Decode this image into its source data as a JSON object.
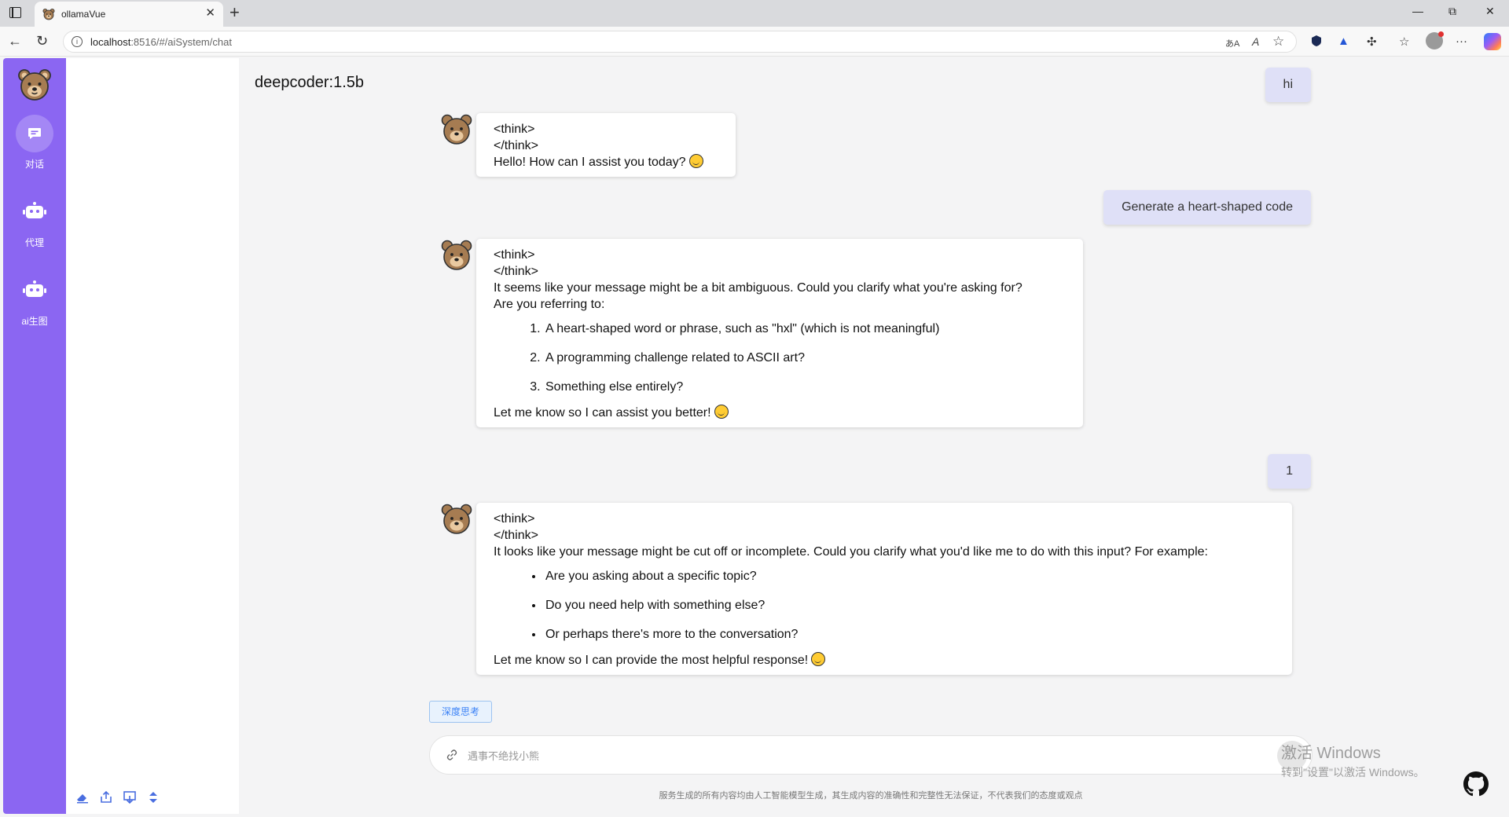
{
  "browser": {
    "tab_title": "ollamaVue",
    "tab_close": "✕",
    "new_tab": "+",
    "url_host": "localhost",
    "url_path": ":8516/#/aiSystem/chat",
    "win_min": "—",
    "win_restore": "⧉",
    "win_close": "✕",
    "back": "←",
    "reload": "↻",
    "translate": "あA",
    "read_aloud": "A",
    "favorite": "☆",
    "more": "···"
  },
  "sidebar": {
    "items": [
      {
        "label": "对话",
        "icon": "chat-icon"
      },
      {
        "label": "代理",
        "icon": "robot-icon"
      },
      {
        "label": "ai生图",
        "icon": "robot-icon"
      }
    ],
    "accent": "#8b66f2"
  },
  "bottom_tools": [
    "eraser-icon",
    "upload-icon",
    "download-icon",
    "sort-icon"
  ],
  "chat": {
    "model_name": "deepcoder:1.5b",
    "messages": [
      {
        "role": "user",
        "text": "hi"
      },
      {
        "role": "ai",
        "think_open": "<think>",
        "think_close": "</think>",
        "text": "Hello! How can I assist you today?"
      },
      {
        "role": "user",
        "text": "Generate a heart-shaped code"
      },
      {
        "role": "ai",
        "think_open": "<think>",
        "think_close": "</think>",
        "intro": "It seems like your message might be a bit ambiguous. Could you clarify what you're asking for?",
        "intro2": "Are you referring to:",
        "list": [
          "A heart-shaped word or phrase, such as \"hxl\" (which is not meaningful)",
          "A programming challenge related to ASCII art?",
          "Something else entirely?"
        ],
        "outro": "Let me know so I can assist you better!"
      },
      {
        "role": "user",
        "text": "1"
      },
      {
        "role": "ai",
        "think_open": "<think>",
        "think_close": "</think>",
        "intro": "It looks like your message might be cut off or incomplete. Could you clarify what you'd like me to do with this input? For example:",
        "list": [
          "Are you asking about a specific topic?",
          "Do you need help with something else?",
          "Or perhaps there's more to the conversation?"
        ],
        "outro": "Let me know so I can provide the most helpful response!"
      }
    ]
  },
  "composer": {
    "deep_think_label": "深度思考",
    "placeholder": "遇事不绝找小熊",
    "footer_note": "服务生成的所有内容均由人工智能模型生成，其生成内容的准确性和完整性无法保证，不代表我们的态度或观点"
  },
  "watermark": {
    "line1": "激活 Windows",
    "line2": "转到\"设置\"以激活 Windows。"
  }
}
